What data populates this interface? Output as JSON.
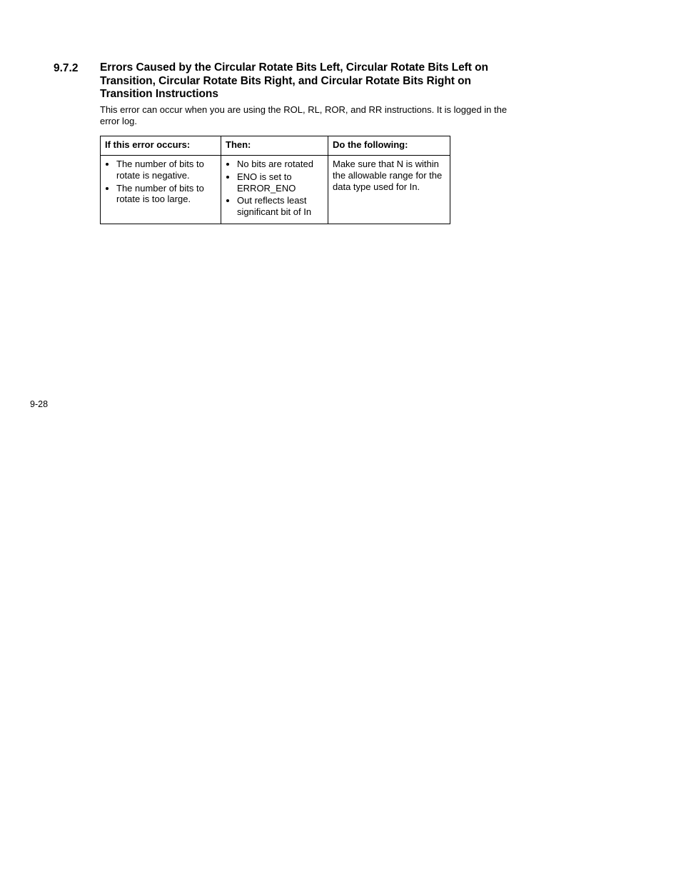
{
  "section_number": "9.7.2",
  "heading": "Errors Caused by the Circular Rotate Bits Left, Circular Rotate Bits Left on Transition, Circular Rotate Bits Right, and Circular Rotate Bits Right on Transition Instructions",
  "body": "This error can occur when you are using the ROL, RL, ROR, and RR instructions. It is logged in the error log.",
  "table": {
    "headers": [
      "If this error occurs:",
      "Then:",
      "Do the following:"
    ],
    "rows": [
      {
        "if": [
          "The number of bits to rotate is negative.",
          "The number of bits to rotate is too large."
        ],
        "then": [
          "No bits are rotated",
          "ENO is set to ERROR_ENO",
          "Out reflects least significant bit of In"
        ],
        "do": "Make sure that N is within the allowable range for the data type used for In."
      }
    ]
  },
  "page_number": "9-28"
}
